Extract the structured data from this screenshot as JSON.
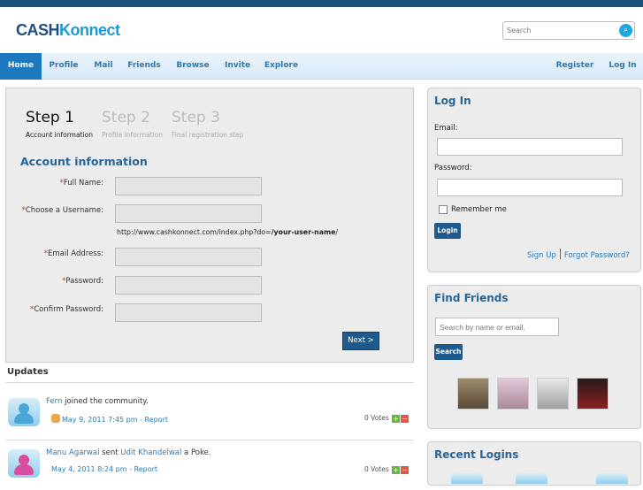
{
  "header": {
    "logo": {
      "part1": "CASH",
      "part2": "Konnect"
    },
    "search": {
      "placeholder": "Search"
    },
    "search_button_glyph": "⌕",
    "brand_color": "#1f4e85"
  },
  "nav": {
    "items": [
      {
        "label": "Home",
        "active": true
      },
      {
        "label": "Profile"
      },
      {
        "label": "Mail"
      },
      {
        "label": "Friends"
      },
      {
        "label": "Browse"
      },
      {
        "label": "Invite"
      },
      {
        "label": "Explore"
      }
    ],
    "right": [
      {
        "label": "Register"
      },
      {
        "label": "Log In"
      }
    ],
    "active_color": "#1d78bd"
  },
  "steps": [
    {
      "num": "Step 1",
      "sub": "Account information"
    },
    {
      "num": "Step 2",
      "sub": "Profile information"
    },
    {
      "num": "Step 3",
      "sub": "Final registration step"
    }
  ],
  "form": {
    "title": "Account information",
    "required_mark": "*",
    "fields": [
      {
        "label": "Full Name:",
        "value": ""
      },
      {
        "label": "Choose a Username:",
        "value": ""
      },
      {
        "label": "Email Address:",
        "value": ""
      },
      {
        "label": "Password:",
        "value": ""
      },
      {
        "label": "Confirm Password:",
        "value": ""
      }
    ],
    "url_hint_prefix": "http://www.cashkonnect.com/index.php?do=",
    "url_hint_bold": "/your-user-name",
    "url_hint_suffix": "/",
    "next_label": "Next >"
  },
  "updates": {
    "title": "Updates",
    "items": [
      {
        "user": "Fern",
        "text": " joined the community.",
        "date": "May 9, 2011 7:45 pm",
        "report": "- Report",
        "votes": "0 Votes",
        "avatar": "blue"
      },
      {
        "user": "Manu Agarwal",
        "text": " sent ",
        "target": "Udit Khandelwal",
        "text2": " a Poke.",
        "date": "May 4, 2011 8:24 pm",
        "report": "- Report",
        "votes": "0 Votes",
        "avatar": "pink"
      }
    ]
  },
  "login": {
    "title": "Log In",
    "email_label": "Email:",
    "password_label": "Password:",
    "remember_label": "Remember me",
    "button": "Login",
    "signup": "Sign Up",
    "forgot": "Forgot Password?"
  },
  "find_friends": {
    "title": "Find Friends",
    "placeholder": "Search by name or email.",
    "button": "Search",
    "thumbnails": [
      {
        "name": "friend-photo-1",
        "color": "#8a7a5a"
      },
      {
        "name": "friend-photo-2",
        "color": "#c9a9b9"
      },
      {
        "name": "friend-photo-3",
        "color": "#c8c8c8"
      },
      {
        "name": "friend-photo-4",
        "color": "#6b1a1a"
      }
    ]
  },
  "recent_logins": {
    "title": "Recent Logins"
  }
}
